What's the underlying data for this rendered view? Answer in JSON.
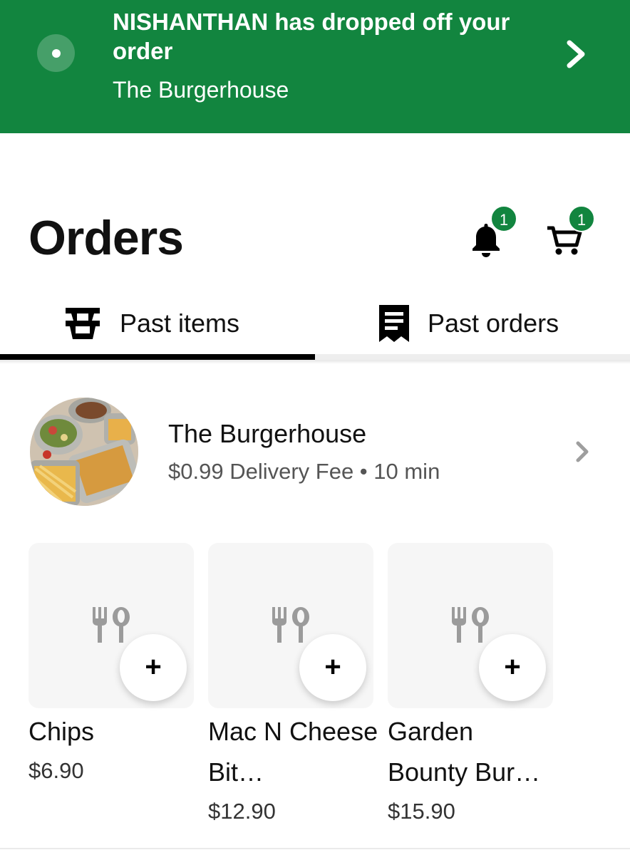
{
  "banner": {
    "title": "NISHANTHAN has dropped off your order",
    "subtitle": "The Burgerhouse",
    "color": "#12853f"
  },
  "header": {
    "title": "Orders",
    "notifications_count": "1",
    "cart_count": "1"
  },
  "tabs": [
    {
      "label": "Past items",
      "icon": "basket-icon",
      "active": true
    },
    {
      "label": "Past orders",
      "icon": "receipt-icon",
      "active": false
    }
  ],
  "store": {
    "name": "The Burgerhouse",
    "meta": "$0.99 Delivery Fee • 10 min"
  },
  "items": [
    {
      "name": "Chips",
      "price": "$6.90"
    },
    {
      "name": "Mac N Cheese Bit…",
      "price": "$12.90"
    },
    {
      "name": "Garden Bounty Bur…",
      "price": "$15.90"
    }
  ]
}
